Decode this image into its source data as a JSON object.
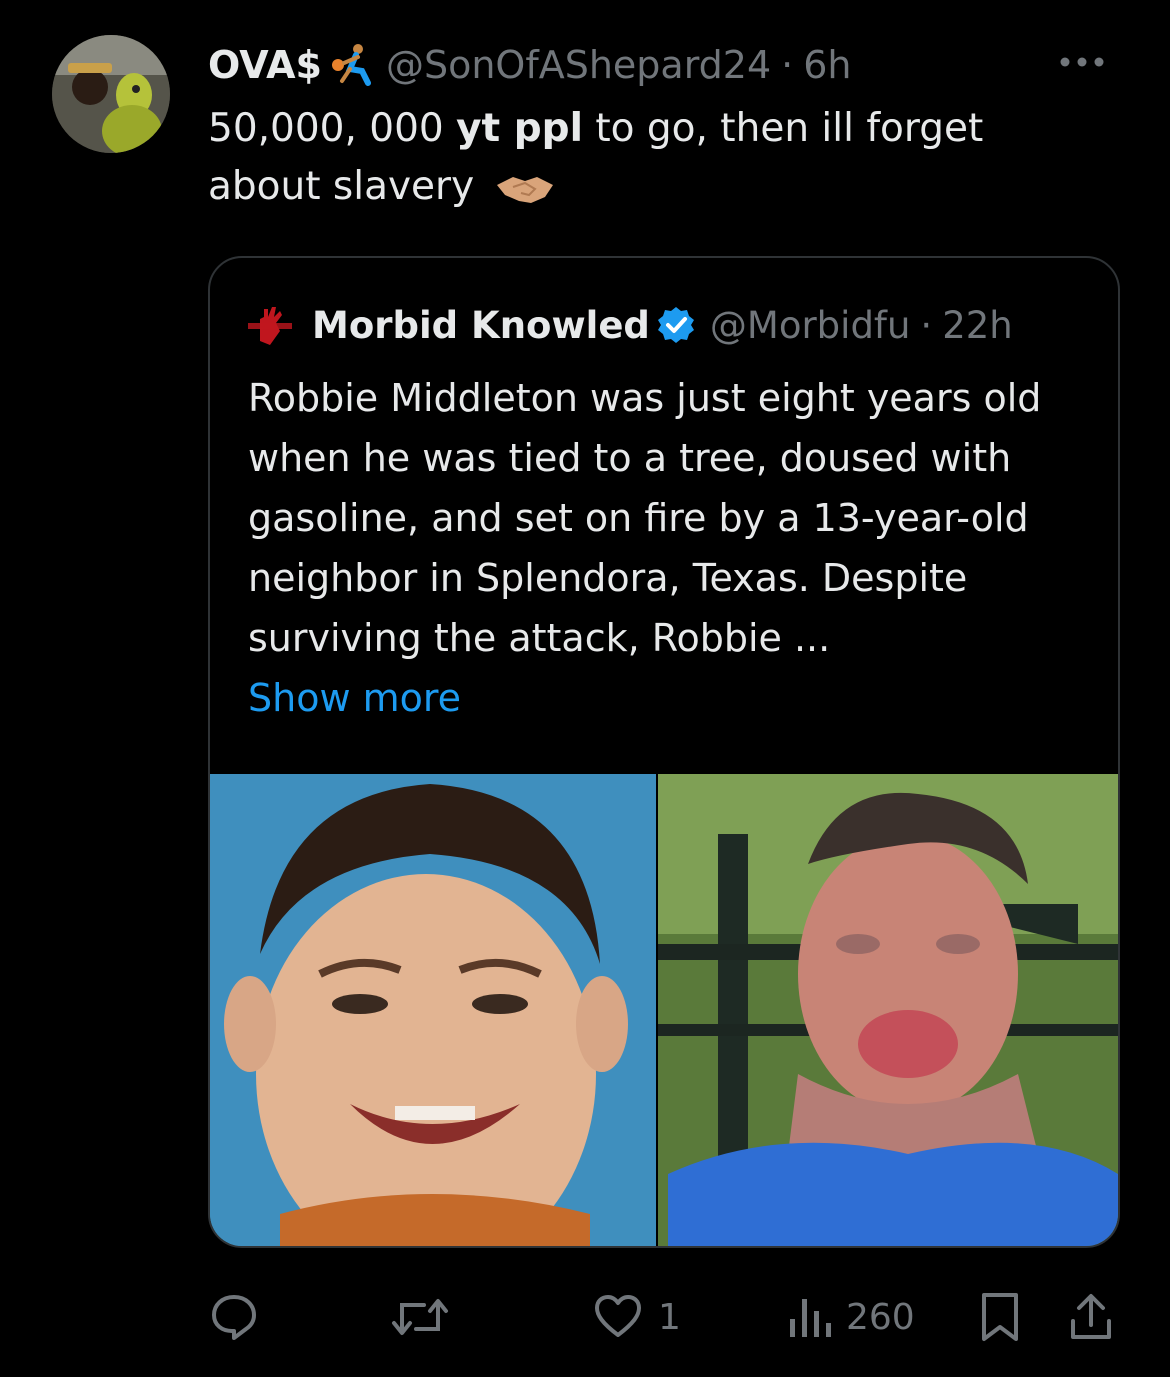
{
  "tweet": {
    "display_name": "OVA$",
    "handle": "@SonOfAShepard24",
    "separator": "·",
    "time": "6h",
    "text_part1": "50,000, 000 ",
    "text_bold": "yt ppl",
    "text_part2": " to go, then ill forget about slavery"
  },
  "quoted": {
    "display_name": "Morbid Knowled",
    "handle": "@Morbidfu",
    "separator": "·",
    "time": "22h",
    "text": "Robbie Middleton was just eight years old when he was tied to a tree, doused with gasoline, and set on fire by a 13-year-old neighbor in Splendora, Texas. Despite surviving the attack, Robbie ...",
    "show_more": "Show more"
  },
  "actions": {
    "reply_count": "",
    "retweet_count": "",
    "like_count": "1",
    "views_count": "260"
  },
  "colors": {
    "background": "#000000",
    "text_primary": "#e7e9ea",
    "text_secondary": "#71767b",
    "accent": "#1d9bf0",
    "border": "#2f3336"
  },
  "icons": [
    "more-icon",
    "handshake-icon",
    "verified-badge-icon",
    "reply-icon",
    "retweet-icon",
    "like-icon",
    "views-icon",
    "bookmark-icon",
    "share-icon"
  ]
}
